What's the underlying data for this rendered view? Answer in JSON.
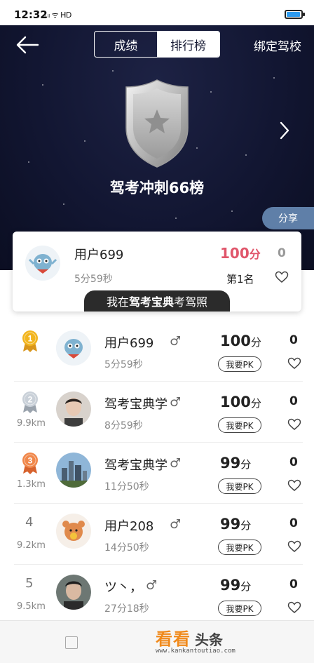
{
  "status_bar": {
    "time": "12:32",
    "signal_text": "ᵢₗ.ᵢₗ ᯤ HD",
    "battery_level": 0.85
  },
  "nav": {
    "tabs": [
      {
        "label": "成绩",
        "active": false
      },
      {
        "label": "排行榜",
        "active": true
      }
    ],
    "bind_label": "绑定驾校"
  },
  "board": {
    "title": "驾考冲刺66榜",
    "share_label": "分享"
  },
  "my_entry": {
    "name": "用户699",
    "time": "5分59秒",
    "score": "100",
    "score_unit": "分",
    "rank": "第1名",
    "likes": "0"
  },
  "slogan": {
    "prefix": "我在",
    "brand": "驾考宝典",
    "suffix": "考驾照"
  },
  "rankings": [
    {
      "rank": "1",
      "medal": "gold",
      "distance": "",
      "name": "用户699",
      "gender": "♂",
      "time": "5分59秒",
      "score": "100",
      "score_unit": "分",
      "pk_label": "我要PK",
      "likes": "0",
      "avatar": "cartoon-mascot"
    },
    {
      "rank": "2",
      "medal": "silver",
      "distance": "9.9km",
      "name": "驾考宝典学",
      "gender": "♂",
      "time": "8分59秒",
      "score": "100",
      "score_unit": "分",
      "pk_label": "我要PK",
      "likes": "0",
      "avatar": "man-photo"
    },
    {
      "rank": "3",
      "medal": "bronze",
      "distance": "1.3km",
      "name": "驾考宝典学",
      "gender": "♂",
      "time": "11分50秒",
      "score": "99",
      "score_unit": "分",
      "pk_label": "我要PK",
      "likes": "0",
      "avatar": "city-photo"
    },
    {
      "rank": "4",
      "medal": "",
      "distance": "9.2km",
      "name": "用户208",
      "gender": "♂",
      "time": "14分50秒",
      "score": "99",
      "score_unit": "分",
      "pk_label": "我要PK",
      "likes": "0",
      "avatar": "cartoon-bear"
    },
    {
      "rank": "5",
      "medal": "",
      "distance": "9.5km",
      "name": "ツ丶，",
      "gender": "♂",
      "time": "27分18秒",
      "score": "99",
      "score_unit": "分",
      "pk_label": "我要PK",
      "likes": "0",
      "avatar": "man-photo-2"
    }
  ],
  "watermark": {
    "text_a": "看看",
    "text_b": "头条",
    "url": "www.kankantoutiao.com"
  },
  "colors": {
    "header_bg": "#121632",
    "score_highlight": "#e0566b",
    "share_bg": "#5f7fa8",
    "brand_orange": "#f08a1c"
  }
}
